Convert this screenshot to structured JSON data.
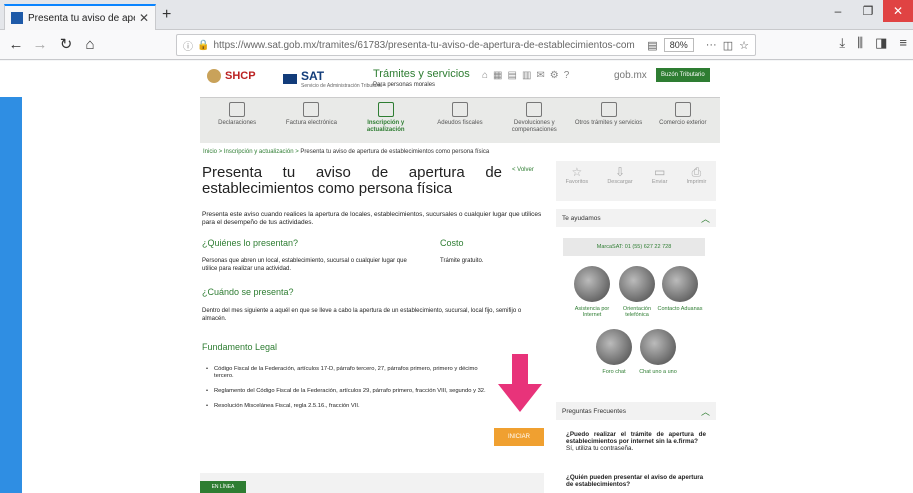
{
  "browser": {
    "tab_title": "Presenta tu aviso de apertura d",
    "url": "https://www.sat.gob.mx/tramites/61783/presenta-tu-aviso-de-apertura-de-establecimientos-com",
    "zoom": "80%"
  },
  "header": {
    "shcp": "SHCP",
    "sat": "SAT",
    "sat_sub": "Servicio de Administración Tributaria",
    "tramites": "Trámites y servicios",
    "tramites_sub": "Para personas morales",
    "gobmx": "gob.mx",
    "buzon": "Buzón Tributario"
  },
  "menu": [
    {
      "label": "Declaraciones"
    },
    {
      "label": "Factura electrónica"
    },
    {
      "label": "Inscripción y actualización"
    },
    {
      "label": "Adeudos fiscales"
    },
    {
      "label": "Devoluciones y compensaciones"
    },
    {
      "label": "Otros trámites y servicios"
    },
    {
      "label": "Comercio exterior"
    }
  ],
  "breadcrumb": {
    "home": "Inicio",
    "sep": " > ",
    "section": "Inscripción y actualización",
    "current": "Presenta tu aviso de apertura de establecimientos como persona física"
  },
  "main": {
    "title": "Presenta tu aviso de apertura de establecimientos como persona física",
    "volver": "< Volver",
    "intro": "Presenta este aviso cuando realices la apertura de locales, establecimientos, sucursales o cualquier lugar que utilices para el desempeño de tus actividades.",
    "quienes_h": "¿Quiénes lo presentan?",
    "quienes_t": "Personas que abren un local, establecimiento, sucursal o cualquier lugar que utilice para realizar una actividad.",
    "costo_h": "Costo",
    "costo_t": "Trámite gratuito.",
    "cuando_h": "¿Cuándo se presenta?",
    "cuando_t": "Dentro del mes siguiente a aquél en que se lleve a cabo la apertura de un establecimiento, sucursal, local fijo, semifijo o almacén.",
    "fund_h": "Fundamento Legal",
    "fund_items": [
      "Código Fiscal de la Federación, artículos 17-D, párrafo tercero, 27, párrafos primero, primero y décimo tercero.",
      "Reglamento del Código Fiscal de la Federación, artículos 29, párrafo primero, fracción VIII, segundo y 32.",
      "Resolución Miscelánea Fiscal, regla 2.5.16., fracción VII."
    ],
    "iniciar": "INICIAR",
    "enlinea": "EN LÍNEA"
  },
  "sidebar": {
    "tools": [
      {
        "icon": "star-icon",
        "glyph": "☆",
        "label": "Favoritos"
      },
      {
        "icon": "download-icon",
        "glyph": "⇩",
        "label": "Descargar"
      },
      {
        "icon": "send-icon",
        "glyph": "▭",
        "label": "Enviar"
      },
      {
        "icon": "print-icon",
        "glyph": "⎙",
        "label": "Imprimir"
      }
    ],
    "ayudamos": "Te ayudamos",
    "marcasat": "MarcaSAT: 01 (55) 627 22 728",
    "help": [
      {
        "label": "Asistencia por Internet"
      },
      {
        "label": "Orientación telefónica"
      },
      {
        "label": "Contacto Aduanas"
      },
      {
        "label": "Foro chat"
      },
      {
        "label": "Chat uno a uno"
      }
    ],
    "faq_h": "Preguntas Frecuentes",
    "faq1_q": "¿Puedo realizar el trámite de apertura de establecimientos por internet sin la e.firma?",
    "faq1_a": "Sí, utiliza tu contraseña.",
    "faq2_q": "¿Quién pueden presentar el aviso de apertura de establecimientos?"
  },
  "colors": {
    "accent": "#2e7d32",
    "button": "#f0a030",
    "arrow": "#e8337a"
  }
}
